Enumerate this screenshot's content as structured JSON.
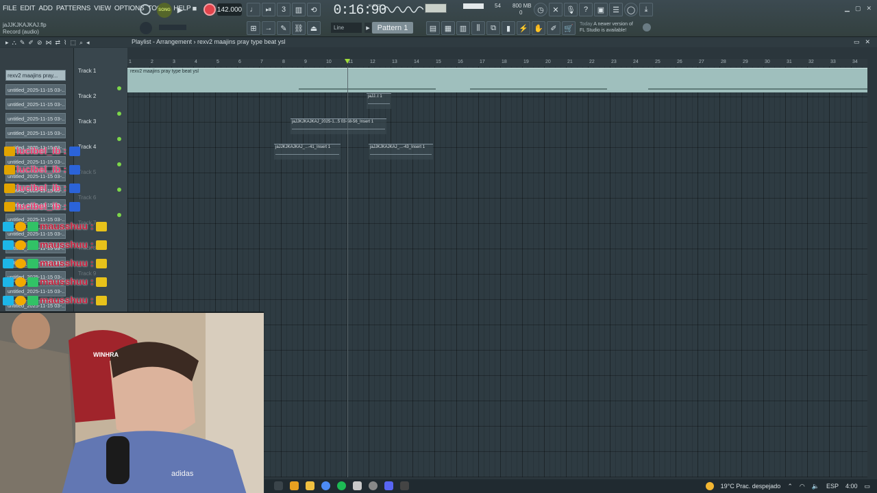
{
  "menu": [
    "FILE",
    "EDIT",
    "ADD",
    "PATTERNS",
    "VIEW",
    "OPTIONS",
    "TOOLS",
    "HELP"
  ],
  "file_info": {
    "filename": "jaJJKJKAJKAJ.flp",
    "mode": "Record (audio)"
  },
  "transport": {
    "song_label": "SONG",
    "tempo": "142.000",
    "time": "0:16:90",
    "time_unit": "M:S:CS"
  },
  "cpu": {
    "mem": "800 MB",
    "cpu_value": "54",
    "voices": "0"
  },
  "toolbar": {
    "snap": "Line",
    "pattern": "Pattern 1"
  },
  "news": {
    "when": "Today",
    "text": "A newer version of",
    "text2": "FL Studio is available!"
  },
  "playlist": {
    "breadcrumb": "Playlist - Arrangement › rexv2 maajins pray type beat ysl",
    "tracks": [
      "Track 1",
      "Track 2",
      "Track 3",
      "Track 4",
      "Track 5",
      "Track 6",
      "Track 7",
      "Track 8",
      "Track 9"
    ],
    "ruler": [
      "1",
      "2",
      "3",
      "4",
      "5",
      "6",
      "7",
      "8",
      "9",
      "10",
      "11",
      "12",
      "13",
      "14",
      "15",
      "16",
      "17",
      "18",
      "19",
      "20",
      "21",
      "22",
      "23",
      "24",
      "25",
      "26",
      "27",
      "28",
      "29",
      "30",
      "31",
      "32",
      "33",
      "34"
    ],
    "audio_clip": "rexv2  maajins  pray type beat ysl",
    "clips": [
      {
        "label": "jaJJ..t 1"
      },
      {
        "label": "jaJJKJKAJKAJ_2025-1...5 03-58-56_Insert 1"
      },
      {
        "label": "jaJJKJKAJKAJ_...-41_Insert 1"
      },
      {
        "label": "jaJJKJKAJKAJ_...-43_Insert 1"
      }
    ]
  },
  "browser": {
    "items": [
      "rexv2 maajins pray...",
      "untitled_2025-11-15 03-...",
      "untitled_2025-11-15 03-...",
      "untitled_2025-11-15 03-...",
      "untitled_2025-11-15 03-...",
      "untitled_2025-11-15 03-...",
      "untitled_2025-11-15 03-...",
      "untitled_2025-11-15 03-...",
      "untitled_2025-11-15 03-...",
      "untitled_2025-11-15 03-...",
      "untitled_2025-11-15 03-...",
      "untitled_2025-11-15 03-...",
      "untitled_2025-11-15 03-...",
      "untitled_2025-11-15 03-...",
      "untitled_2025-11-15 03-...",
      "untitled_2025-11-15 03-...",
      "untitled_2025-11-15 03-..."
    ]
  },
  "chat": {
    "user1": "lucibel_ib",
    "user2": "mausshuu",
    "sep": ":"
  },
  "webcam": {
    "shirt_text": "adidas",
    "chair_text": "WINHRA"
  },
  "taskbar": {
    "weather": "19°C  Prac. despejado",
    "lang": "ESP",
    "clock": "4:00"
  },
  "colors": {
    "record": "#e2434b",
    "accent": "#9fdc3a",
    "chat_user1": "#ec3f73",
    "chat_user2": "#c81f3d"
  }
}
